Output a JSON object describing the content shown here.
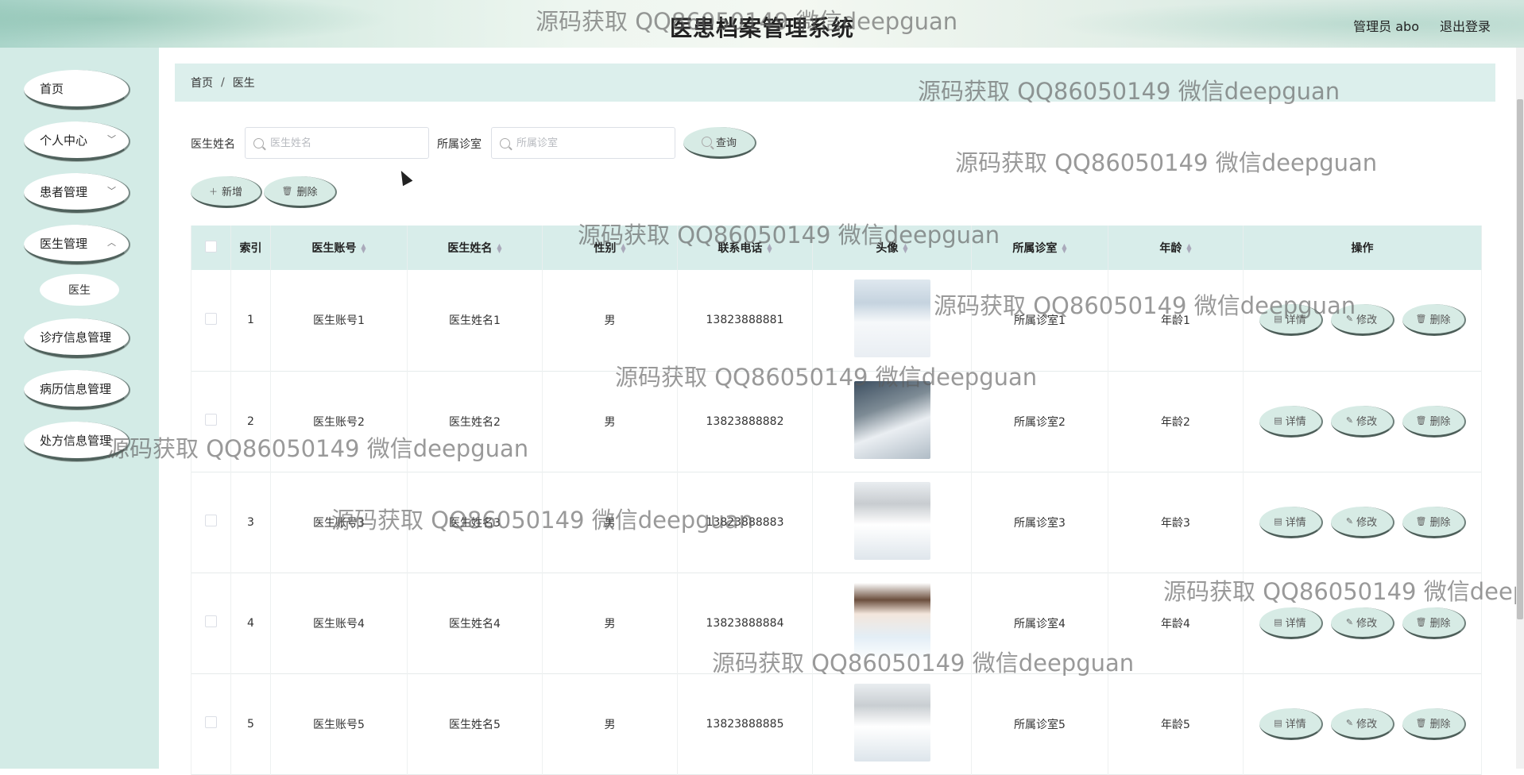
{
  "header": {
    "title": "医患档案管理系统",
    "user": "管理员 abo",
    "logout": "退出登录"
  },
  "sidebar": {
    "items": [
      {
        "label": "首页"
      },
      {
        "label": "个人中心"
      },
      {
        "label": "患者管理"
      },
      {
        "label": "医生管理"
      },
      {
        "label": "医生"
      },
      {
        "label": "诊疗信息管理"
      },
      {
        "label": "病历信息管理"
      },
      {
        "label": "处方信息管理"
      }
    ]
  },
  "breadcrumb": {
    "home": "首页",
    "sep": "/",
    "current": "医生"
  },
  "search": {
    "name_label": "医生姓名",
    "name_placeholder": "医生姓名",
    "room_label": "所属诊室",
    "room_placeholder": "所属诊室",
    "query": "查询"
  },
  "actions": {
    "add": "新增",
    "delete": "删除"
  },
  "table": {
    "columns": [
      "索引",
      "医生账号",
      "医生姓名",
      "性别",
      "联系电话",
      "头像",
      "所属诊室",
      "年龄",
      "操作"
    ],
    "rows": [
      {
        "index": "1",
        "account": "医生账号1",
        "name": "医生姓名1",
        "gender": "男",
        "phone": "13823888881",
        "room": "所属诊室1",
        "age": "年龄1"
      },
      {
        "index": "2",
        "account": "医生账号2",
        "name": "医生姓名2",
        "gender": "男",
        "phone": "13823888882",
        "room": "所属诊室2",
        "age": "年龄2"
      },
      {
        "index": "3",
        "account": "医生账号3",
        "name": "医生姓名3",
        "gender": "男",
        "phone": "13823888883",
        "room": "所属诊室3",
        "age": "年龄3"
      },
      {
        "index": "4",
        "account": "医生账号4",
        "name": "医生姓名4",
        "gender": "男",
        "phone": "13823888884",
        "room": "所属诊室4",
        "age": "年龄4"
      },
      {
        "index": "5",
        "account": "医生账号5",
        "name": "医生姓名5",
        "gender": "男",
        "phone": "13823888885",
        "room": "所属诊室5",
        "age": "年龄5"
      }
    ],
    "ops": {
      "detail": "详情",
      "edit": "修改",
      "del": "删除"
    }
  },
  "watermark": "源码获取 QQ86050149 微信deepguan"
}
